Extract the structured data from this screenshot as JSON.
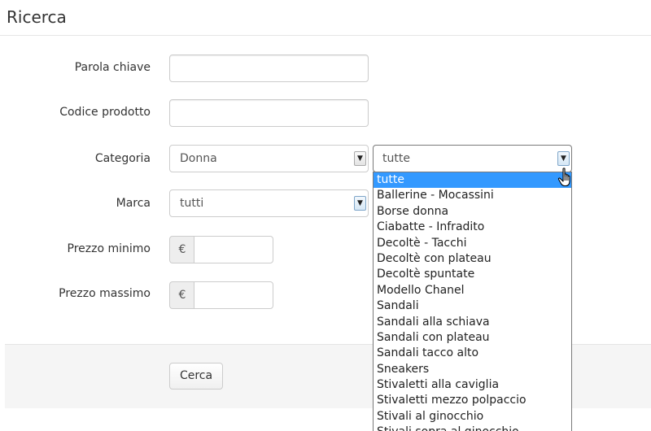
{
  "page_title": "Ricerca",
  "fields": {
    "keyword_label": "Parola chiave",
    "code_label": "Codice prodotto",
    "category_label": "Categoria",
    "category_value": "Donna",
    "subcategory_value": "tutte",
    "brand_label": "Marca",
    "brand_value": "tutti",
    "min_price_label": "Prezzo minimo",
    "max_price_label": "Prezzo massimo",
    "currency_symbol": "€"
  },
  "search_button": "Cerca",
  "subcategory_options": [
    "tutte",
    "Ballerine - Mocassini",
    "Borse donna",
    "Ciabatte - Infradito",
    "Decoltè - Tacchi",
    "Decoltè con plateau",
    "Decoltè spuntate",
    "Modello Chanel",
    "Sandali",
    "Sandali alla schiava",
    "Sandali con plateau",
    "Sandali tacco alto",
    "Sneakers",
    "Stivaletti alla caviglia",
    "Stivaletti mezzo polpaccio",
    "Stivali al ginocchio",
    "Stivali sopra al ginocchio"
  ],
  "selected_option_index": 0,
  "icons": {
    "select_arrow": "chevron-down-icon",
    "cursor": "hand-pointer-icon"
  }
}
